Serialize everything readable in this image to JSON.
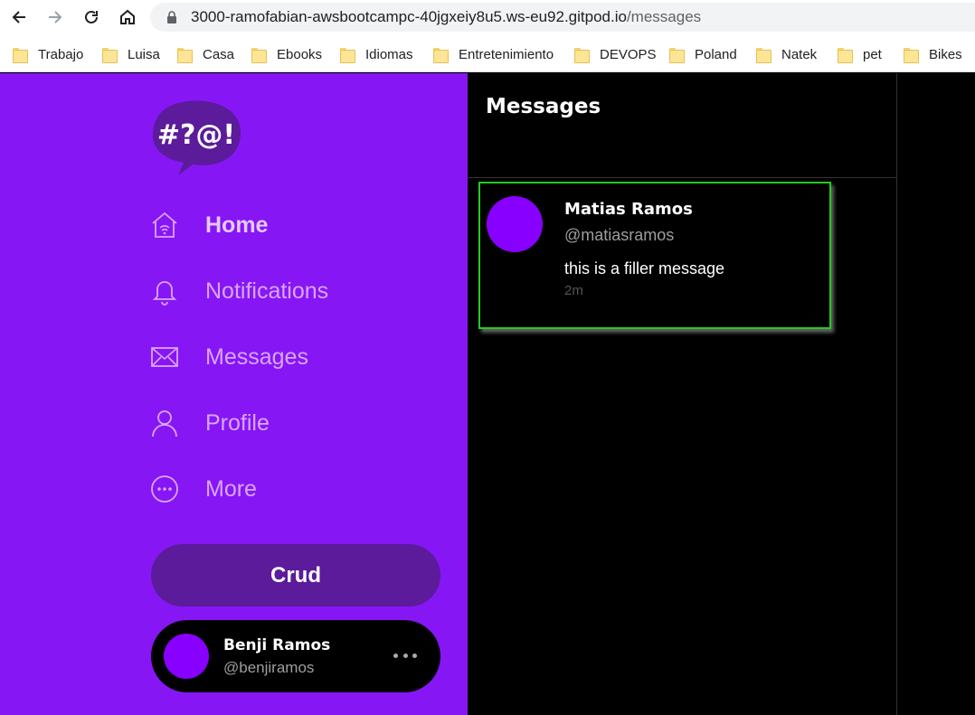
{
  "browser": {
    "url_host": "3000-ramofabian-awsbootcampc-40jgxeiy8u5.ws-eu92.gitpod.io",
    "url_path": "/messages",
    "bookmarks": [
      {
        "label": "Trabajo"
      },
      {
        "label": "Luisa"
      },
      {
        "label": "Casa"
      },
      {
        "label": "Ebooks"
      },
      {
        "label": "Idiomas"
      },
      {
        "label": "Entretenimiento"
      },
      {
        "label": "DEVOPS"
      },
      {
        "label": "Poland"
      },
      {
        "label": "Natek"
      },
      {
        "label": "pet"
      },
      {
        "label": "Bikes"
      }
    ]
  },
  "sidebar": {
    "logo_text": "#?@!",
    "items": [
      {
        "label": "Home",
        "icon": "home-icon",
        "active": true
      },
      {
        "label": "Notifications",
        "icon": "bell-icon",
        "active": false
      },
      {
        "label": "Messages",
        "icon": "envelope-icon",
        "active": false
      },
      {
        "label": "Profile",
        "icon": "person-icon",
        "active": false
      },
      {
        "label": "More",
        "icon": "more-circle-icon",
        "active": false
      }
    ],
    "crud_label": "Crud",
    "profile": {
      "name": "Benji Ramos",
      "handle": "@benjiramos"
    }
  },
  "main": {
    "title": "Messages",
    "messages": [
      {
        "name": "Matias Ramos",
        "handle": "@matiasramos",
        "text": "this is a filler message",
        "time": "2m"
      }
    ]
  },
  "colors": {
    "sidebar_bg": "#8716f5",
    "crud_bg": "#5b1b9b",
    "avatar": "#8800ff",
    "highlight_border": "#22cc22"
  }
}
